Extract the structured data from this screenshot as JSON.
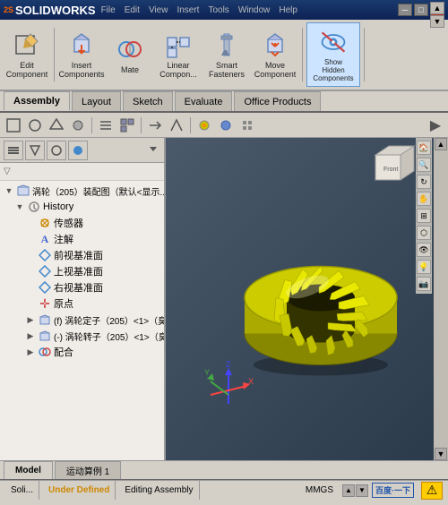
{
  "titlebar": {
    "logo_ds": "2S",
    "logo_sw": "SOLIDWORKS",
    "title": "",
    "btn_minimize": "─",
    "btn_maximize": "□",
    "btn_close": "✕"
  },
  "menubar": {
    "items": [
      "File",
      "Edit",
      "View",
      "Insert",
      "Tools",
      "Window",
      "Help"
    ]
  },
  "toolbar": {
    "items": [
      {
        "id": "edit-component",
        "label": "Edit\nComponent",
        "icon": "edit-component-icon"
      },
      {
        "id": "insert-components",
        "label": "Insert\nComponents",
        "icon": "insert-components-icon"
      },
      {
        "id": "mate",
        "label": "Mate",
        "icon": "mate-icon"
      },
      {
        "id": "linear-component",
        "label": "Linear\nCompon...",
        "icon": "linear-component-icon"
      },
      {
        "id": "smart-fasteners",
        "label": "Smart\nFasteners",
        "icon": "smart-fasteners-icon"
      },
      {
        "id": "move-component",
        "label": "Move\nComponent",
        "icon": "move-component-icon"
      },
      {
        "id": "show-hidden",
        "label": "Show\nHidden\nComponents",
        "icon": "show-hidden-icon",
        "active": true
      }
    ]
  },
  "tabs": {
    "items": [
      "Assembly",
      "Layout",
      "Sketch",
      "Evaluate",
      "Office Products"
    ],
    "active": "Assembly"
  },
  "secondary_toolbar": {
    "buttons": [
      "◁",
      "▷",
      "⊕",
      "⊙",
      "☰",
      "≡",
      "◈",
      "◻",
      "⬡",
      "⊞",
      "↕",
      "🔍",
      "⊘",
      "⊕",
      "⊗"
    ]
  },
  "panel_toolbar": {
    "buttons": [
      "📁",
      "⬡",
      "◉",
      "🔵"
    ]
  },
  "filter_bar": {
    "icon": "▽",
    "text": ""
  },
  "tree": {
    "title": "涡轮（205）装配图（默认<显示...",
    "items": [
      {
        "id": "history",
        "label": "History",
        "icon": "⏱",
        "level": 1,
        "expand": "▼"
      },
      {
        "id": "sensor",
        "label": "传感器",
        "icon": "📡",
        "level": 2,
        "expand": ""
      },
      {
        "id": "annotation",
        "label": "注解",
        "icon": "A",
        "level": 2,
        "expand": ""
      },
      {
        "id": "front-plane",
        "label": "前视基准面",
        "icon": "◻",
        "level": 2,
        "expand": ""
      },
      {
        "id": "top-plane",
        "label": "上视基准面",
        "icon": "◻",
        "level": 2,
        "expand": ""
      },
      {
        "id": "right-plane",
        "label": "右视基准面",
        "icon": "◻",
        "level": 2,
        "expand": ""
      },
      {
        "id": "origin",
        "label": "原点",
        "icon": "✛",
        "level": 2,
        "expand": ""
      },
      {
        "id": "stator",
        "label": "(f) 涡轮定子（205）<1>（臭...",
        "icon": "⬡",
        "level": 2,
        "expand": "▶"
      },
      {
        "id": "rotor",
        "label": "(-) 涡轮转子（205）<1>（臭...",
        "icon": "⬡",
        "level": 2,
        "expand": "▶"
      },
      {
        "id": "mate",
        "label": "配合",
        "icon": "♦",
        "level": 2,
        "expand": "▶"
      }
    ]
  },
  "bottom_tabs": {
    "items": [
      "Model",
      "运动算例 1"
    ],
    "active": "Model"
  },
  "statusbar": {
    "app": "Soli...",
    "status": "Under Defined",
    "mode": "Editing Assembly",
    "units": "MMGS",
    "baidu": "百度·一下"
  },
  "viewport": {
    "background_top": "#4a5a6a",
    "background_bottom": "#2a3a4a",
    "torus_color": "#cccc00",
    "torus_inner_color": "#999900"
  }
}
